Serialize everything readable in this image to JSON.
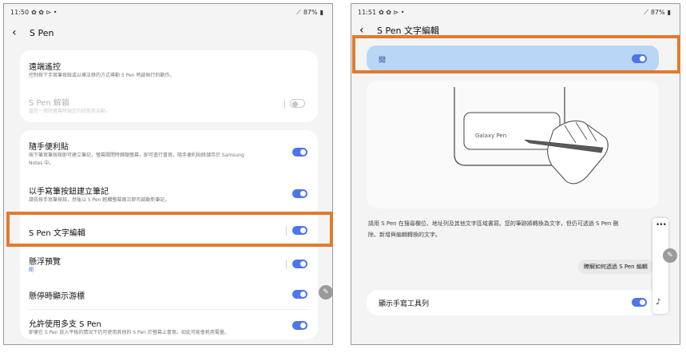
{
  "left": {
    "status": {
      "time": "11:50",
      "icons": "✿ ✿ ⊳ •",
      "battery": "87%"
    },
    "title": "S Pen",
    "items": [
      {
        "title": "遠端遙控",
        "subtitle": "控制按下手寫筆按鈕或以揮法移的方式導動 S Pen 時啟執行的動作。"
      },
      {
        "title": "S Pen 解鎖",
        "subtitle": "當您一撥除螢幕時鎖定的狀態將自動。"
      },
      {
        "title": "隨手便利貼",
        "subtitle": "按下筆寫筆按鈕即可建立筆記，螢幕關閉時歸類螢幕，即可進行書寫，隨手便利貼將儲存於 Samsung",
        "subtitle2": "Notes 中。"
      },
      {
        "title": "以手寫筆按鈕建立筆記",
        "subtitle": "請長按手寫筆按鈕，然後以 S Pen 輕觸螢幕兩次即可啟動新筆記。"
      },
      {
        "title": "S Pen 文字編輯"
      },
      {
        "title": "懸浮預覽",
        "subtitle": "開"
      },
      {
        "title": "懸停時顯示游標"
      },
      {
        "title": "允許使用多支 S Pen",
        "subtitle": "即便在 S Pen 放入平板的情況下仍可使用其他的 S Pen 於螢幕上書寫。如此可能會耗用電量。"
      }
    ]
  },
  "right": {
    "status": {
      "time": "11:51",
      "icons": "✿ ✿ ⊳ •",
      "battery": "87%"
    },
    "title": "S Pen 文字編輯",
    "master_toggle_label": "開",
    "illustration_label": "Galaxy Pen",
    "description_line1": "請用 S Pen 在搜尋欄位、地址列及其他文字區域書寫。您的筆跡將轉換為文字，但仍可透過 S Pen 刪",
    "description_line2": "除、新增與編輯轉換的文字。",
    "learn_more": "瞭解如何透過 S Pen 編輯",
    "toolbar_label": "顯示手寫工具列"
  },
  "colors": {
    "highlight": "#e07b2e",
    "toggle_on": "#4f76e8",
    "toggle_row_bg": "#b9d6f6"
  },
  "icons": {
    "back": "chevron-left-icon",
    "fab": "pen-icon",
    "more": "more-dots-icon",
    "sound": "sound-icon"
  }
}
